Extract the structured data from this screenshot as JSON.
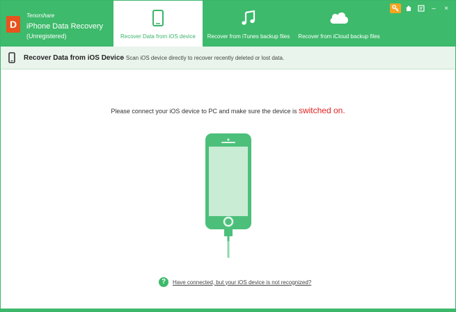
{
  "brand": {
    "logo_letter": "D",
    "company": "Tenorshare",
    "product": "iPhone Data Recovery",
    "registration": "(Unregistered)"
  },
  "tabs": [
    {
      "label": "Recover Data from iOS device",
      "icon": "phone-icon",
      "active": true
    },
    {
      "label": "Recover from iTunes backup files",
      "icon": "music-note-icon",
      "active": false
    },
    {
      "label": "Recover from iCloud backup files",
      "icon": "cloud-icon",
      "active": false
    }
  ],
  "window_controls": {
    "key": "key-icon",
    "home": "home-icon",
    "feedback": "feedback-icon",
    "minimize": "–",
    "close": "×"
  },
  "subheader": {
    "title": "Recover Data from iOS Device",
    "description": "- Scan iOS device directly to recover recently deleted or lost data."
  },
  "main": {
    "instruction_prefix": "Please connect your iOS device to PC and make sure the device is",
    "instruction_highlight": "switched on.",
    "help_icon": "?",
    "help_link": "Have connected, but your iOS device is not recognized?"
  },
  "colors": {
    "brand_green": "#3dba6b",
    "phone_green": "#4cc07a",
    "highlight_red": "#e02020",
    "key_orange": "#f5a623"
  }
}
